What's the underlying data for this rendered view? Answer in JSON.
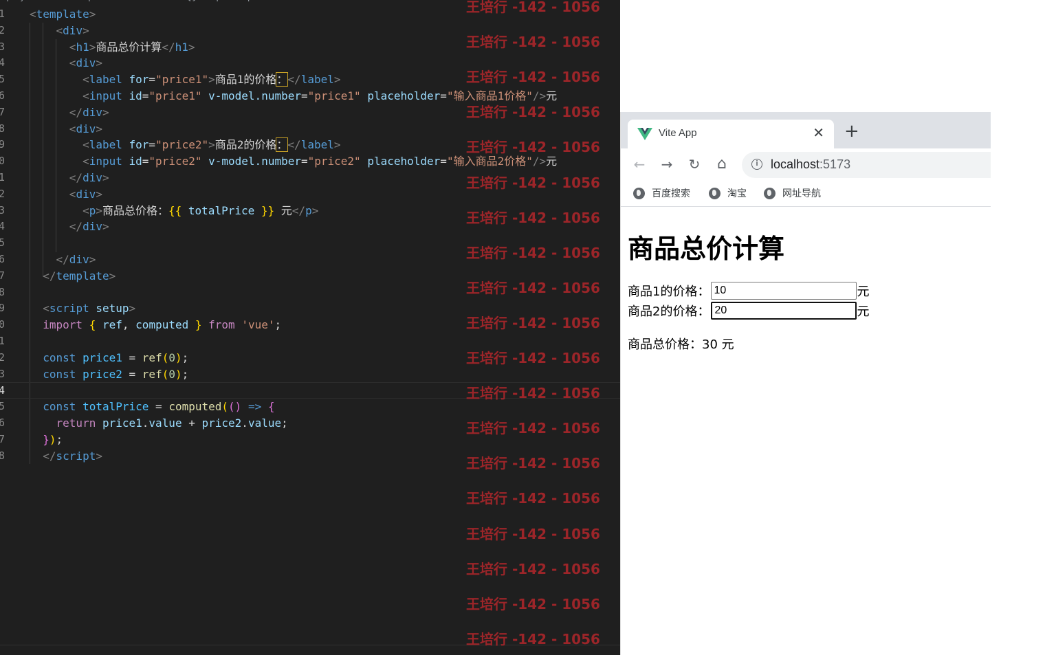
{
  "editor": {
    "breadcrumb": "› project › src › components › ▾ add.vue › {} script setup",
    "lines": [
      {
        "n": "1"
      },
      {
        "n": "2"
      },
      {
        "n": "3"
      },
      {
        "n": "4"
      },
      {
        "n": "5"
      },
      {
        "n": "6"
      },
      {
        "n": "7"
      },
      {
        "n": "8"
      },
      {
        "n": "9"
      },
      {
        "n": "0"
      },
      {
        "n": "1"
      },
      {
        "n": "2"
      },
      {
        "n": "3"
      },
      {
        "n": "4"
      },
      {
        "n": "5"
      },
      {
        "n": "6"
      },
      {
        "n": "7"
      },
      {
        "n": "8"
      },
      {
        "n": "9"
      },
      {
        "n": "0"
      },
      {
        "n": "1"
      },
      {
        "n": "2"
      },
      {
        "n": "3"
      },
      {
        "n": "4"
      },
      {
        "n": "5"
      },
      {
        "n": "6"
      },
      {
        "n": "7"
      },
      {
        "n": "8"
      }
    ],
    "code": {
      "h1_text": "商品总价计算",
      "label1_text": "商品1的价格",
      "label2_text": "商品2的价格",
      "colon": "：",
      "price1": "\"price1\"",
      "price2": "\"price2\"",
      "placeholder1": "\"输入商品1价格\"",
      "placeholder2": "\"输入商品2价格\"",
      "yuan": "元",
      "p_text": "商品总价格：",
      "total_expr": "totalPrice",
      "vue_str": "'vue'"
    }
  },
  "watermark": {
    "text": "王培行 -142 - 1056",
    "count": 19
  },
  "browser": {
    "tab_title": "Vite App",
    "close_glyph": "✕",
    "newtab_glyph": "+",
    "url_host": "localhost",
    "url_port": ":5173",
    "info_glyph": "i",
    "nav": {
      "back": "←",
      "forward": "→",
      "reload": "↻",
      "home": "⌂"
    },
    "bookmarks": [
      "百度搜索",
      "淘宝",
      "网址导航"
    ]
  },
  "page": {
    "title": "商品总价计算",
    "label1": "商品1的价格：",
    "label2": "商品2的价格：",
    "value1": "10",
    "value2": "20",
    "placeholder1": "输入商品1价格",
    "placeholder2": "输入商品2价格",
    "unit": "元",
    "total_label": "商品总价格：",
    "total_value": "30",
    "total_unit": " 元"
  }
}
